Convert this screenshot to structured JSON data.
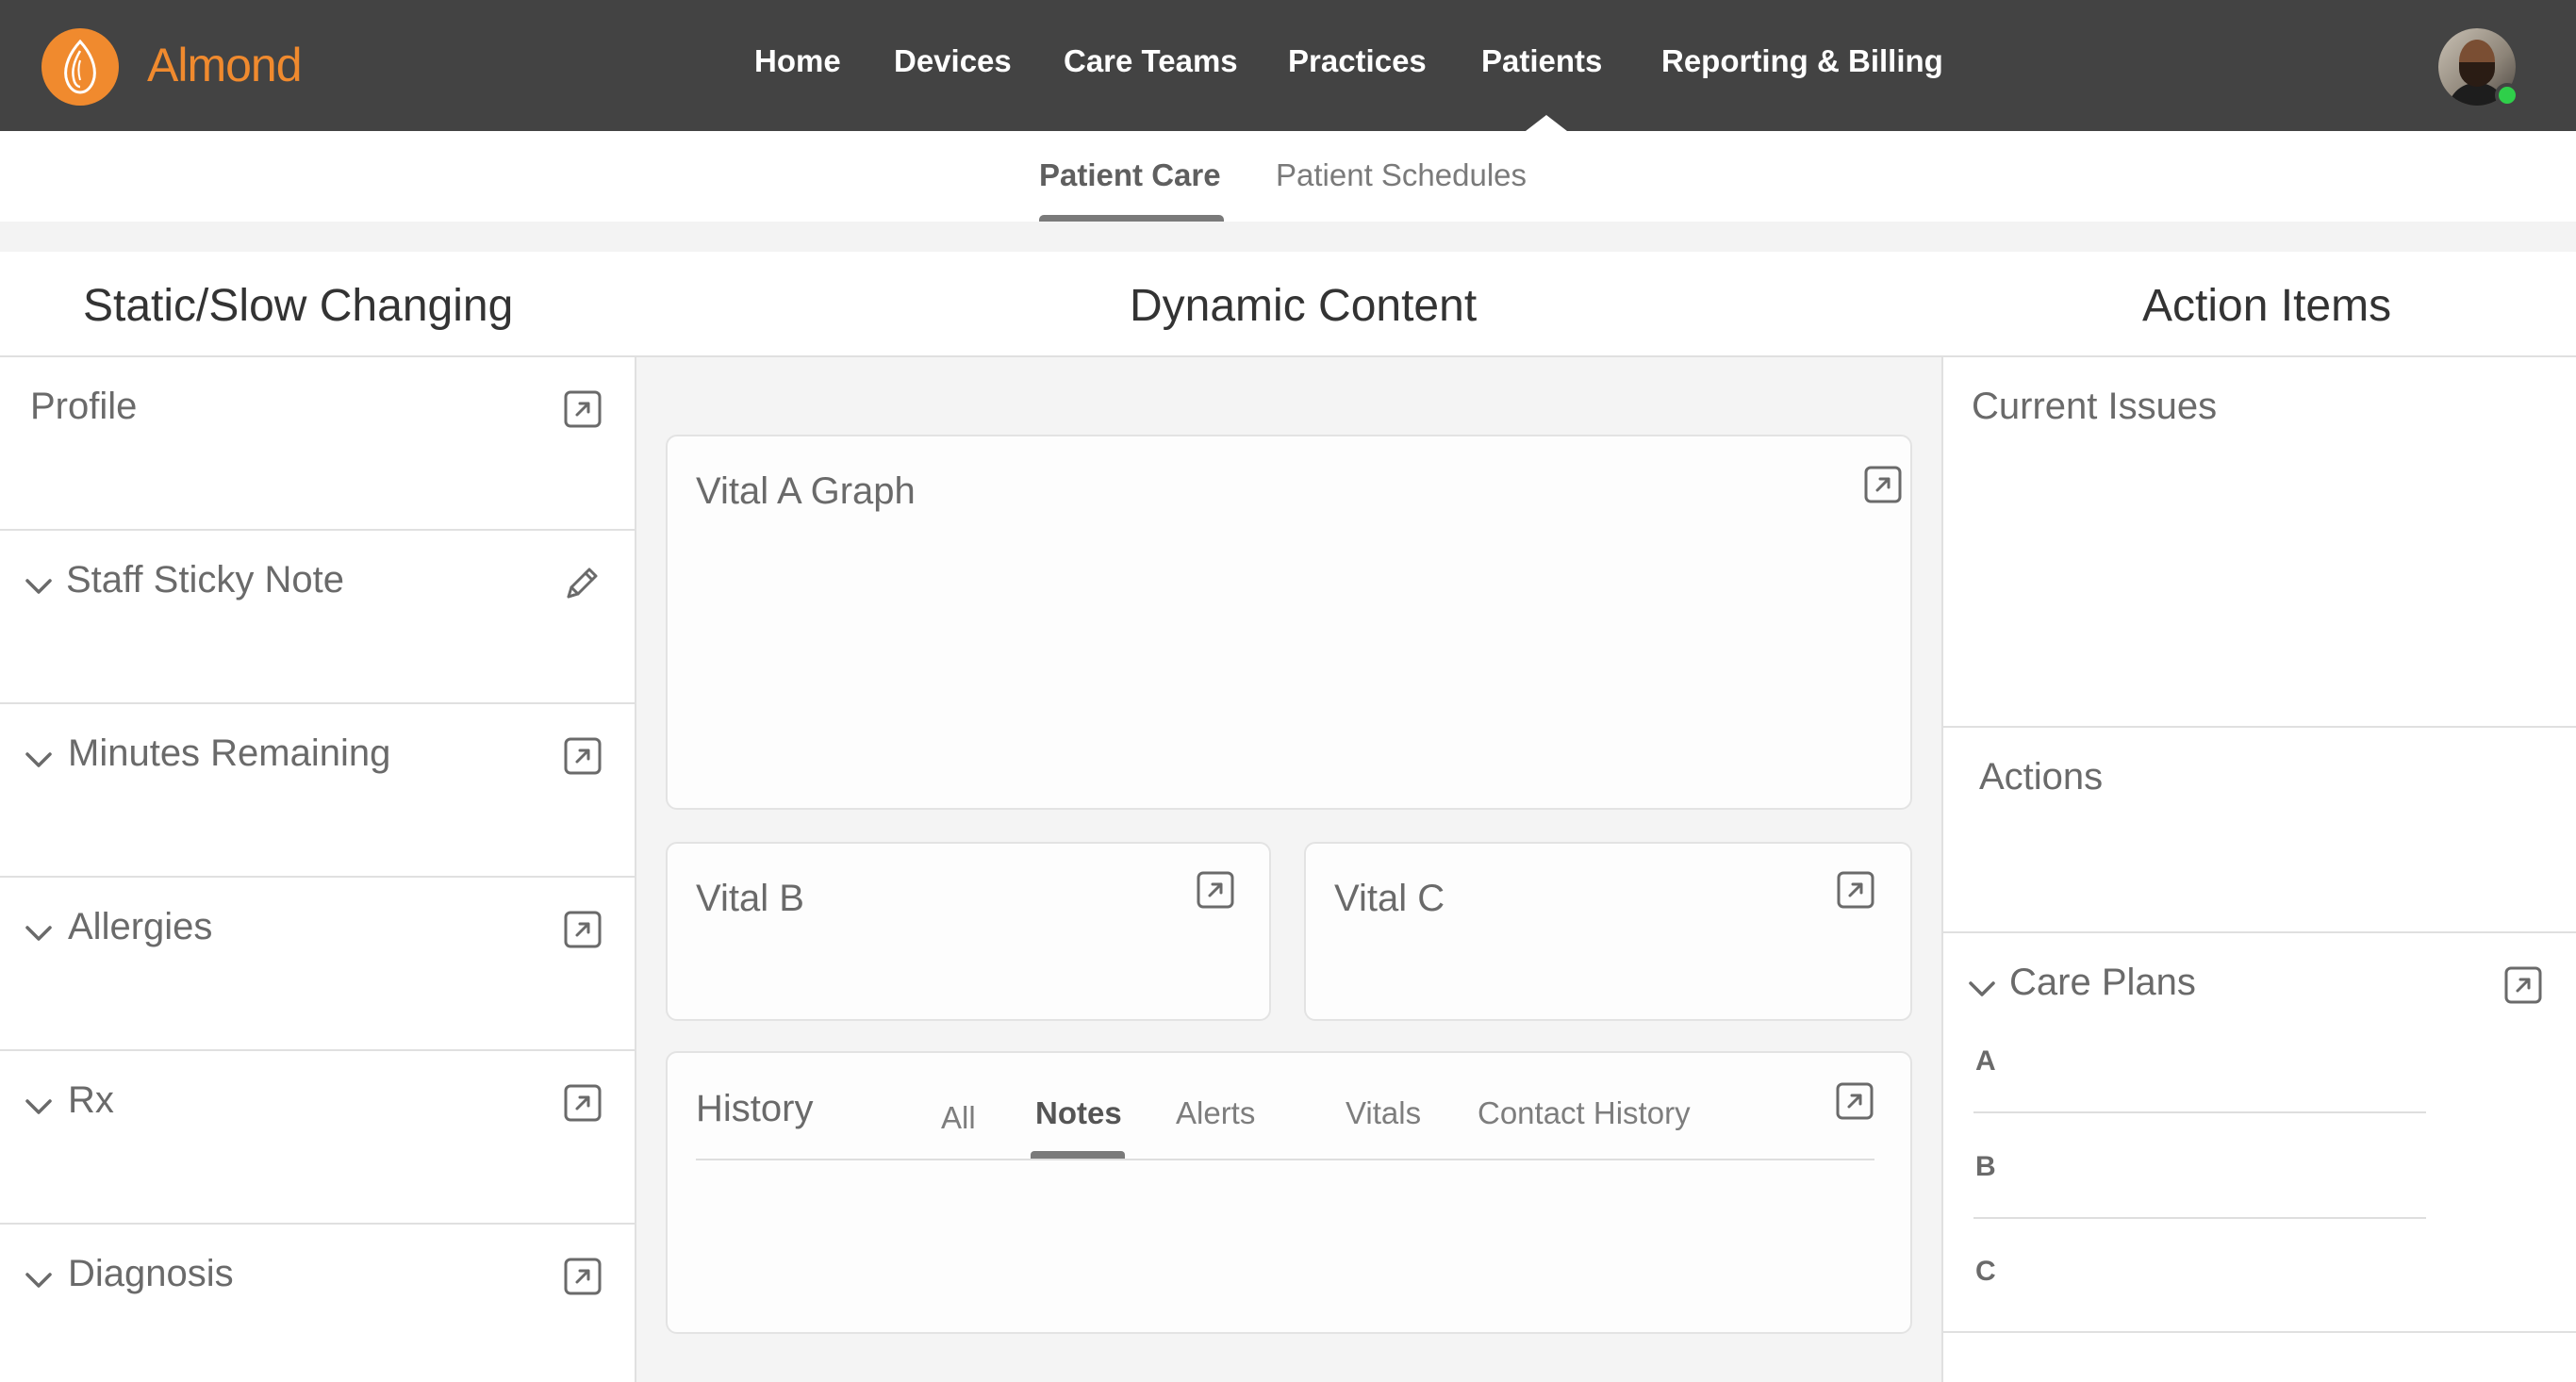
{
  "app": {
    "brand": "Almond",
    "accent_color": "#f08a2e",
    "topbar_color": "#434343"
  },
  "nav": {
    "items": [
      "Home",
      "Devices",
      "Care Teams",
      "Practices",
      "Patients",
      "Reporting & Billing"
    ],
    "active": "Patients"
  },
  "user": {
    "avatar_icon": "user-avatar",
    "status": "online",
    "status_color": "#2fcf4a"
  },
  "subnav": {
    "tabs": [
      "Patient Care",
      "Patient Schedules"
    ],
    "active": "Patient Care"
  },
  "columns": {
    "left_title": "Static/Slow Changing",
    "middle_title": "Dynamic Content",
    "right_title": "Action Items"
  },
  "left_panels": [
    {
      "title": "Profile",
      "collapsible": false,
      "action_icon": "expand-icon"
    },
    {
      "title": "Staff Sticky Note",
      "collapsible": true,
      "action_icon": "pencil-icon"
    },
    {
      "title": "Minutes Remaining",
      "collapsible": true,
      "action_icon": "expand-icon"
    },
    {
      "title": "Allergies",
      "collapsible": true,
      "action_icon": "expand-icon"
    },
    {
      "title": "Rx",
      "collapsible": true,
      "action_icon": "expand-icon"
    },
    {
      "title": "Diagnosis",
      "collapsible": true,
      "action_icon": "expand-icon"
    }
  ],
  "middle": {
    "vital_a": "Vital A Graph",
    "vital_b": "Vital B",
    "vital_c": "Vital C",
    "history": {
      "title": "History",
      "tabs": [
        "All",
        "Notes",
        "Alerts",
        "Vitals",
        "Contact History"
      ],
      "active": "Notes"
    }
  },
  "right": {
    "current_issues": "Current Issues",
    "actions": "Actions",
    "care_plans": {
      "title": "Care Plans",
      "items": [
        "A",
        "B",
        "C"
      ]
    }
  }
}
